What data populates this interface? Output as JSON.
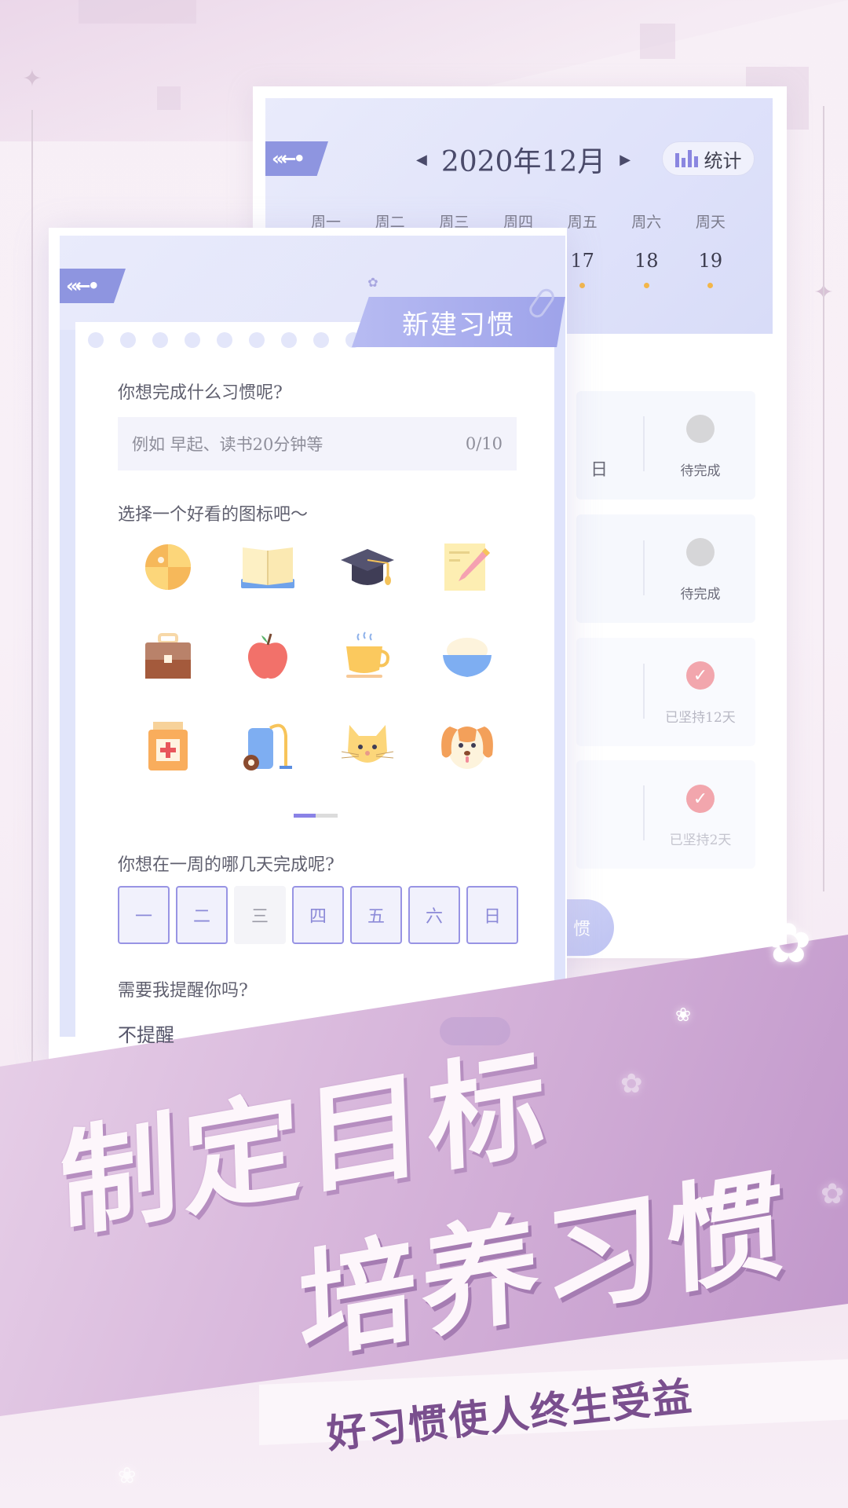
{
  "calendar_screen": {
    "back_icon": "back-arrow-icon",
    "month_title": "2020年12月",
    "prev_icon": "caret-left-icon",
    "next_icon": "caret-right-icon",
    "stats_button": {
      "icon": "bar-chart-icon",
      "label": "统计"
    },
    "weekdays": [
      "周一",
      "周二",
      "周三",
      "周四",
      "周五",
      "周六",
      "周天"
    ],
    "visible_dates": [
      {
        "day": "17",
        "has_dot": true
      },
      {
        "day": "18",
        "has_dot": true
      },
      {
        "day": "19",
        "has_dot": true
      }
    ],
    "habits": [
      {
        "partial_label": "日",
        "status": "pending",
        "status_text": "待完成"
      },
      {
        "partial_label": "",
        "status": "pending",
        "status_text": "待完成"
      },
      {
        "partial_label": "",
        "status": "done",
        "status_text": "已坚持12天"
      },
      {
        "partial_label": "",
        "status": "done",
        "status_text": "已坚持2天"
      }
    ],
    "add_button_partial_label": "惯",
    "colors": {
      "accent": "#8e95e0",
      "dot": "#f3b64a",
      "done": "#f2a6ad",
      "pending": "#d6d6d8"
    }
  },
  "new_habit_screen": {
    "back_icon": "back-arrow-icon",
    "title": "新建习惯",
    "habit_question": "你想完成什么习惯呢?",
    "habit_input": {
      "placeholder": "例如 早起、读书20分钟等",
      "value": "",
      "counter": "0/10"
    },
    "icon_question": "选择一个好看的图标吧～",
    "icons": [
      "beach-ball-icon",
      "open-book-icon",
      "graduation-cap-icon",
      "note-pencil-icon",
      "briefcase-icon",
      "apple-icon",
      "tea-cup-icon",
      "rice-bowl-icon",
      "medicine-bottle-icon",
      "vacuum-cleaner-icon",
      "cat-icon",
      "dog-icon"
    ],
    "icon_pager": {
      "current_page": 1,
      "total_pages": 2
    },
    "days_question": "你想在一周的哪几天完成呢?",
    "days": [
      {
        "label": "一",
        "selected": true
      },
      {
        "label": "二",
        "selected": true
      },
      {
        "label": "三",
        "selected": false
      },
      {
        "label": "四",
        "selected": true
      },
      {
        "label": "五",
        "selected": true
      },
      {
        "label": "六",
        "selected": true
      },
      {
        "label": "日",
        "selected": true
      }
    ],
    "reminder_question": "需要我提醒你吗?",
    "reminder_value": "不提醒",
    "reminder_toggle_on": false,
    "colors": {
      "accent": "#9894e4",
      "ribbon": "#9ea3ea"
    }
  },
  "promo": {
    "headline_line1": "制定目标",
    "headline_line2": "培养习惯",
    "tagline": "好习惯使人终生受益",
    "colors": {
      "banner": "#bf94c9",
      "tagline": "#7a4f8e"
    }
  }
}
